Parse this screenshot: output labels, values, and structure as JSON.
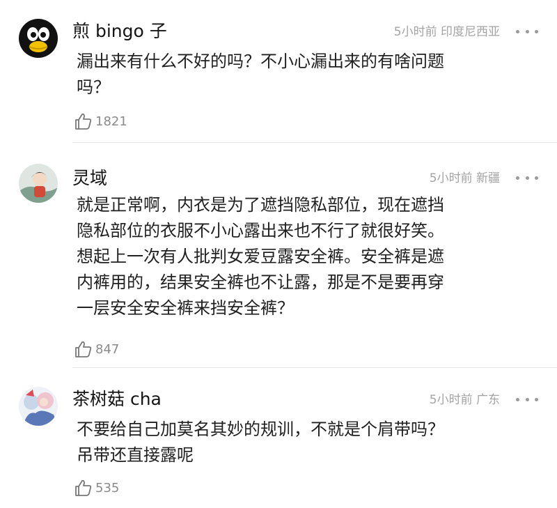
{
  "comments": [
    {
      "username": "煎 bingo 子",
      "time": "5小时前",
      "location": "印度尼西亚",
      "lines": [
        "漏出来有什么不好的吗？不小心漏出来的有啥问题",
        "吗？"
      ],
      "likes": "1821"
    },
    {
      "username": "灵域",
      "time": "5小时前",
      "location": "新疆",
      "lines": [
        "就是正常啊，内衣是为了遮挡隐私部位，现在遮挡",
        "隐私部位的衣服不小心露出来也不行了就很好笑。",
        "想起上一次有人批判女爱豆露安全裤。安全裤是遮",
        "内裤用的，结果安全裤也不让露，那是不是要再穿",
        "一层安全安全裤来挡安全裤？"
      ],
      "likes": "847"
    },
    {
      "username": "茶树菇 cha",
      "time": "5小时前",
      "location": "广东",
      "lines": [
        "不要给自己加莫名其妙的规训，不就是个肩带吗？",
        "吊带还直接露呢"
      ],
      "likes": "535"
    }
  ],
  "icons": {
    "like": "thumbs-up-icon",
    "more": "more-dots-icon"
  },
  "colors": {
    "text": "#1f1f1f",
    "meta": "#a3a3a3",
    "divider": "#e6e6e6"
  }
}
